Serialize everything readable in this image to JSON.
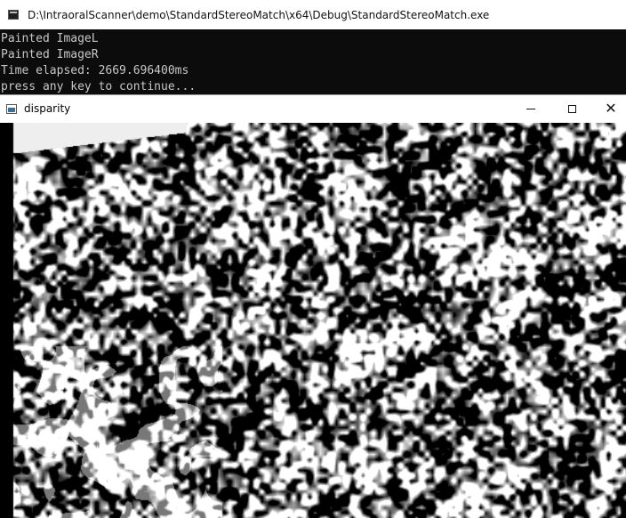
{
  "console": {
    "title": "D:\\IntraoralScanner\\demo\\StandardStereoMatch\\x64\\Debug\\StandardStereoMatch.exe",
    "lines": [
      "Painted ImageL",
      "Painted ImageR",
      "Time elapsed: 2669.696400ms",
      "press any key to continue..."
    ]
  },
  "disparity_window": {
    "title": "disparity",
    "minimize_label": "",
    "maximize_label": "",
    "close_label": "✕"
  },
  "colors": {
    "console_bg": "#0c0c0c",
    "console_text": "#c8c8c8"
  }
}
